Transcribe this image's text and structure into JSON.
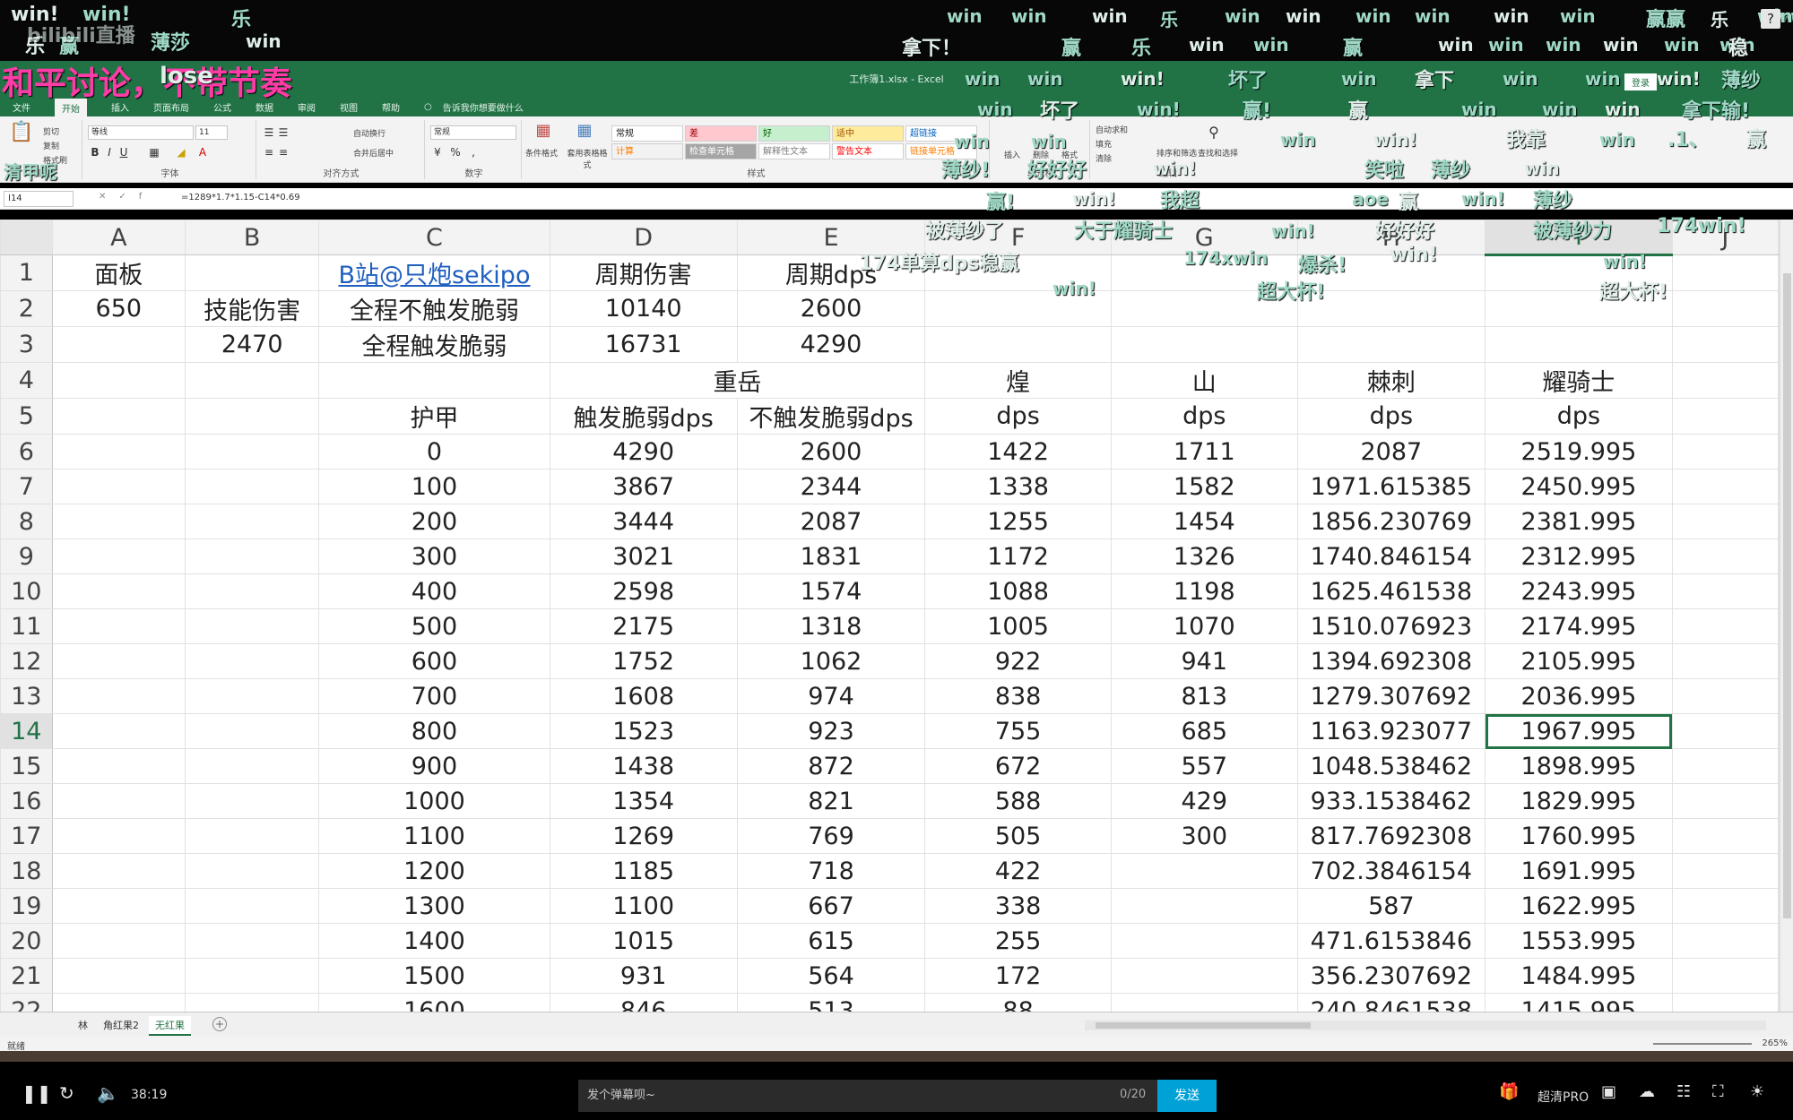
{
  "app": {
    "title": "工作簿1.xlsx - Excel",
    "login_label": "登录",
    "help": "?",
    "tell_me": "告诉我你想要做什么",
    "menus": [
      "文件",
      "开始",
      "插入",
      "页面布局",
      "公式",
      "数据",
      "审阅",
      "视图",
      "帮助"
    ],
    "active_menu_index": 1
  },
  "ribbon": {
    "clipboard": {
      "cut": "剪切",
      "copy": "复制",
      "painter": "格式刷",
      "label": "剪贴板"
    },
    "font": {
      "name": "等线",
      "size": "11",
      "label": "字体"
    },
    "alignment": {
      "wrap": "自动换行",
      "merge": "合并后居中",
      "label": "对齐方式"
    },
    "number": {
      "format": "常规",
      "label": "数字"
    },
    "styles": {
      "conditional": "条件格式",
      "table": "套用表格格式",
      "items": [
        {
          "label": "常规",
          "bg": "#ffffff",
          "fg": "#222222"
        },
        {
          "label": "差",
          "bg": "#ffc7ce",
          "fg": "#9c0006"
        },
        {
          "label": "好",
          "bg": "#c6efce",
          "fg": "#006100"
        },
        {
          "label": "适中",
          "bg": "#ffeb9c",
          "fg": "#9c5700"
        },
        {
          "label": "超链接",
          "bg": "#ffffff",
          "fg": "#0563c1"
        },
        {
          "label": "计算",
          "bg": "#f2f2f2",
          "fg": "#fa7d00"
        },
        {
          "label": "检查单元格",
          "bg": "#a5a5a5",
          "fg": "#ffffff"
        },
        {
          "label": "解释性文本",
          "bg": "#ffffff",
          "fg": "#7f7f7f"
        },
        {
          "label": "警告文本",
          "bg": "#ffffff",
          "fg": "#ff0000"
        },
        {
          "label": "链接单元格",
          "bg": "#ffffff",
          "fg": "#fa7d00"
        }
      ],
      "label": "样式"
    },
    "cells": {
      "insert": "插入",
      "delete": "删除",
      "format": "格式",
      "label": "单元格"
    },
    "editing": {
      "autosum": "自动求和",
      "fill": "填充",
      "clear": "清除",
      "sort": "排序和筛选",
      "find": "查找和选择",
      "label": "编辑"
    }
  },
  "formula_bar": {
    "name_box": "I14",
    "formula": "=1289*1.7*1.15-C14*0.69"
  },
  "sheet": {
    "columns": [
      "A",
      "B",
      "C",
      "D",
      "E",
      "F",
      "G",
      "H",
      "I",
      "J"
    ],
    "selected_column": "I",
    "selected_row": 14,
    "rows": [
      [
        "面板",
        "",
        "B站@只炮sekipo",
        "周期伤害",
        "周期dps",
        "",
        "",
        "",
        "",
        ""
      ],
      [
        "650",
        "技能伤害",
        "全程不触发脆弱",
        "10140",
        "2600",
        "",
        "",
        "",
        "",
        ""
      ],
      [
        "",
        "2470",
        "全程触发脆弱",
        "16731",
        "4290",
        "",
        "",
        "",
        "",
        ""
      ],
      [
        "",
        "",
        "",
        "重岳",
        "",
        "煌",
        "山",
        "棘刺",
        "耀骑士",
        ""
      ],
      [
        "",
        "",
        "护甲",
        "触发脆弱dps",
        "不触发脆弱dps",
        "dps",
        "dps",
        "dps",
        "dps",
        ""
      ],
      [
        "",
        "",
        "0",
        "4290",
        "2600",
        "1422",
        "1711",
        "2087",
        "2519.995",
        ""
      ],
      [
        "",
        "",
        "100",
        "3867",
        "2344",
        "1338",
        "1582",
        "1971.615385",
        "2450.995",
        ""
      ],
      [
        "",
        "",
        "200",
        "3444",
        "2087",
        "1255",
        "1454",
        "1856.230769",
        "2381.995",
        ""
      ],
      [
        "",
        "",
        "300",
        "3021",
        "1831",
        "1172",
        "1326",
        "1740.846154",
        "2312.995",
        ""
      ],
      [
        "",
        "",
        "400",
        "2598",
        "1574",
        "1088",
        "1198",
        "1625.461538",
        "2243.995",
        ""
      ],
      [
        "",
        "",
        "500",
        "2175",
        "1318",
        "1005",
        "1070",
        "1510.076923",
        "2174.995",
        ""
      ],
      [
        "",
        "",
        "600",
        "1752",
        "1062",
        "922",
        "941",
        "1394.692308",
        "2105.995",
        ""
      ],
      [
        "",
        "",
        "700",
        "1608",
        "974",
        "838",
        "813",
        "1279.307692",
        "2036.995",
        ""
      ],
      [
        "",
        "",
        "800",
        "1523",
        "923",
        "755",
        "685",
        "1163.923077",
        "1967.995",
        ""
      ],
      [
        "",
        "",
        "900",
        "1438",
        "872",
        "672",
        "557",
        "1048.538462",
        "1898.995",
        ""
      ],
      [
        "",
        "",
        "1000",
        "1354",
        "821",
        "588",
        "429",
        "933.1538462",
        "1829.995",
        ""
      ],
      [
        "",
        "",
        "1100",
        "1269",
        "769",
        "505",
        "300",
        "817.7692308",
        "1760.995",
        ""
      ],
      [
        "",
        "",
        "1200",
        "1185",
        "718",
        "422",
        "",
        "702.3846154",
        "1691.995",
        ""
      ],
      [
        "",
        "",
        "1300",
        "1100",
        "667",
        "338",
        "",
        "587",
        "1622.995",
        ""
      ],
      [
        "",
        "",
        "1400",
        "1015",
        "615",
        "255",
        "",
        "471.6153846",
        "1553.995",
        ""
      ],
      [
        "",
        "",
        "1500",
        "931",
        "564",
        "172",
        "",
        "356.2307692",
        "1484.995",
        ""
      ],
      [
        "",
        "",
        "1600",
        "846",
        "513",
        "88",
        "",
        "240.8461538",
        "1415.995",
        ""
      ]
    ],
    "tabs": [
      "林",
      "角红果2",
      "无红果"
    ],
    "active_tab_index": 2,
    "status": "就绪",
    "zoom": "265%"
  },
  "overlay": {
    "stream_title": "和平讨论，不带节奏",
    "stream_tag": "lose",
    "live_label": "bilibili直播",
    "danmaku": [
      "win!",
      "win!",
      "乐",
      "乐",
      "赢",
      "薄莎",
      "win",
      "win",
      "win",
      "win",
      "乐",
      "win",
      "win",
      "win",
      "win",
      "win",
      "win",
      "赢赢",
      "乐",
      "win",
      "win",
      "拿下！",
      "赢",
      "乐",
      "win",
      "win",
      "赢",
      "win",
      "win",
      "win",
      "win",
      "win",
      "win",
      "稳",
      "win",
      "win",
      "win!",
      "坏了",
      "win",
      "拿下",
      "win",
      "win",
      "win!",
      "薄纱",
      "win",
      "坏了",
      "win!",
      "赢!",
      "赢",
      "win",
      "win",
      "win",
      "拿下输!",
      "win",
      "win!",
      "win",
      "win",
      "我靠",
      "win",
      ".1、",
      "赢",
      "薄纱!",
      "好好好",
      "win!",
      "笑啦",
      "薄纱",
      "win",
      "清甲呢",
      "赢!",
      "win!",
      "我超",
      "aoe",
      "赢",
      "win!",
      "薄纱",
      "被薄纱了",
      "大于耀骑士",
      "win!",
      "好好好",
      "被薄纱力",
      "174win!",
      "174单算dps稳赢",
      "174xwin",
      "爆杀!",
      "win!",
      "win!",
      "超大杯!",
      "超大杯!",
      "win!"
    ]
  },
  "player": {
    "time": "38:19",
    "danmaku_placeholder": "发个弹幕呗~",
    "counter": "0/20",
    "send_label": "发送",
    "quality": "超清PRO"
  }
}
